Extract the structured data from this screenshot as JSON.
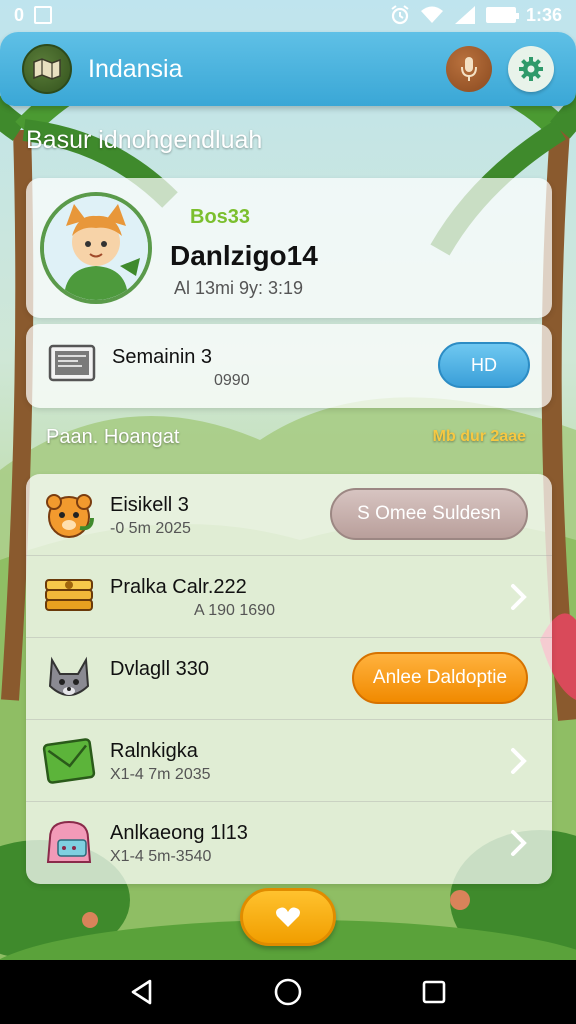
{
  "status_bar": {
    "left_indicator": "0",
    "time": "1:36"
  },
  "app_bar": {
    "title": "Indansia",
    "logo_icon": "map-icon",
    "mic_icon": "mic-icon",
    "settings_icon": "gear-icon"
  },
  "page": {
    "heading": "Basur idnohgendluah"
  },
  "profile": {
    "level": "Bos33",
    "name": "Danlzigo14",
    "meta": "Al 13mi 9y: 3:19"
  },
  "session": {
    "title": "Semainin 3",
    "subtitle": "0990",
    "button_label": "HD"
  },
  "section": {
    "title": "Paan. Hoangat",
    "badge": "Mb dur 2aae"
  },
  "list": {
    "items": [
      {
        "title": "Eisikell 3",
        "subtitle": "-0 5m 2025",
        "action": "S Omee Suldesn",
        "icon": "tiger-icon"
      },
      {
        "title": "Pralka Calr.222",
        "subtitle": "A 190 1690",
        "icon": "coin-stack-icon"
      },
      {
        "title": "Dvlagll 330",
        "subtitle": "",
        "action": "Anlee Daldoptie",
        "icon": "wolf-icon"
      },
      {
        "title": "Ralnkigka",
        "subtitle": "X1-4 7m 2035",
        "icon": "envelope-icon"
      },
      {
        "title": "Anlkaeong 1l13",
        "subtitle": "X1-4 5m-3540",
        "icon": "pink-bag-icon"
      }
    ]
  },
  "fab": {
    "icon": "heart-icon"
  },
  "nav": {
    "back_icon": "back-triangle-icon",
    "home_icon": "home-circle-icon",
    "recents_icon": "recents-square-icon"
  },
  "colors": {
    "app_bar": "#3aa7d6",
    "accent_blue": "#3a9fd8",
    "accent_orange": "#f18a00",
    "badge_yellow": "#f6c842",
    "level_green": "#7bbf2e"
  }
}
